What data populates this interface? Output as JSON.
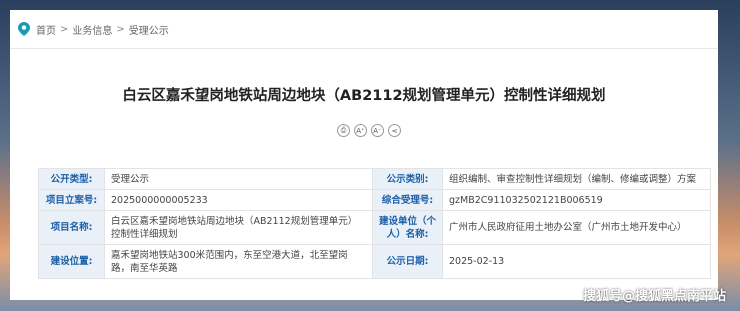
{
  "breadcrumb": [
    "首页",
    "业务信息",
    "受理公示"
  ],
  "breadcrumb_separator": ">",
  "title": "白云区嘉禾望岗地铁站周边地块（AB2112规划管理单元）控制性详细规划",
  "tools": [
    {
      "icon": "print-icon",
      "glyph": "⎙"
    },
    {
      "icon": "font-increase-icon",
      "glyph": "A⁺"
    },
    {
      "icon": "font-decrease-icon",
      "glyph": "A⁻"
    },
    {
      "icon": "share-icon",
      "glyph": "⋖"
    }
  ],
  "info": {
    "row1": {
      "k1": "公开类型:",
      "v1": "受理公示",
      "k2": "公示类别:",
      "v2": "组织编制、审查控制性详细规划（编制、修编或调整）方案"
    },
    "row2": {
      "k1": "项目立案号:",
      "v1": "2025000000005233",
      "k2": "综合受理号:",
      "v2": "gzMB2C911032502121B006519"
    },
    "row3": {
      "k1": "项目名称:",
      "v1": "白云区嘉禾望岗地铁站周边地块（AB2112规划管理单元）控制性详细规划",
      "k2": "建设单位（个人）名称:",
      "v2": "广州市人民政府征用土地办公室（广州市土地开发中心）"
    },
    "row4": {
      "k1": "建设位置:",
      "v1": "嘉禾望岗地铁站300米范围内，东至空港大道，北至望岗路，南至华英路",
      "k2": "公示日期:",
      "v2": "2025-02-13"
    }
  },
  "watermark": "搜狐号@搜狐黑点南平站",
  "colors": {
    "accent": "#1c5fa8",
    "label_bg": "#e9f0f8",
    "pin": "#1a9bb5"
  }
}
